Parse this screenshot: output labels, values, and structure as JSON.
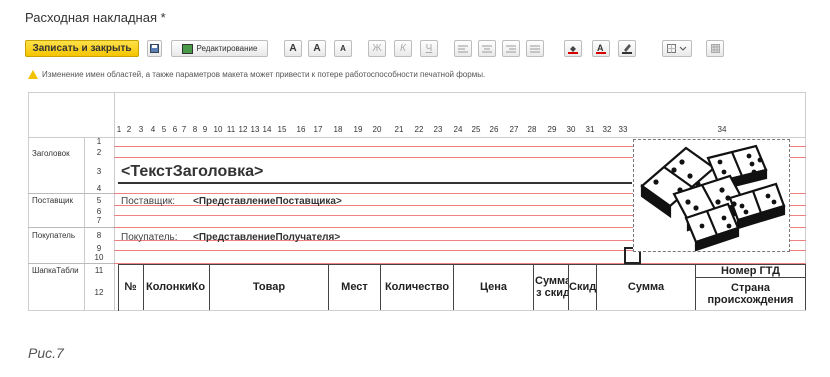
{
  "window": {
    "title": "Расходная накладная *"
  },
  "toolbar": {
    "save_close_label": "Записать и закрыть",
    "edit_label": "Редактирование",
    "font_a": "A",
    "font_a_up": "A",
    "font_a_down": "A",
    "bold": "Ж",
    "italic": "К",
    "underline": "Ч"
  },
  "warning": {
    "text": "Изменение имен областей, а также параметров макета может привести к потере работоспособности печатной формы."
  },
  "sheet": {
    "area_labels": [
      "Заголовок",
      "Поставщик",
      "Покупатель",
      "ШапкаТабли"
    ],
    "row_numbers": [
      "1",
      "2",
      "3",
      "4",
      "5",
      "6",
      "7",
      "8",
      "9",
      "10",
      "11",
      "12"
    ],
    "column_numbers": [
      "1",
      "2",
      "3",
      "4",
      "5",
      "6",
      "7",
      "8",
      "9",
      "10",
      "11",
      "12",
      "13",
      "14",
      "15",
      "16",
      "17",
      "18",
      "19",
      "20",
      "21",
      "22",
      "23",
      "24",
      "25",
      "26",
      "27",
      "28",
      "29",
      "30",
      "31",
      "32",
      "33",
      "34"
    ],
    "header_text": "<ТекстЗаголовка>",
    "supplier_label": "Поставщик:",
    "supplier_value": "<ПредставлениеПоставщика>",
    "buyer_label": "Покупатель:",
    "buyer_value": "<ПредставлениеПолучателя>",
    "table_headers": {
      "num": "№",
      "code": "КолонкиКо",
      "goods": "Товар",
      "places": "Мест",
      "qty": "Количество",
      "price": "Цена",
      "sum_disc": "Сумма\nз скид",
      "disc": "Скидк",
      "sum": "Сумма",
      "gtd": "Номер ГТД",
      "country": "Страна\nпроисхождения"
    }
  },
  "caption": "Рис.7"
}
